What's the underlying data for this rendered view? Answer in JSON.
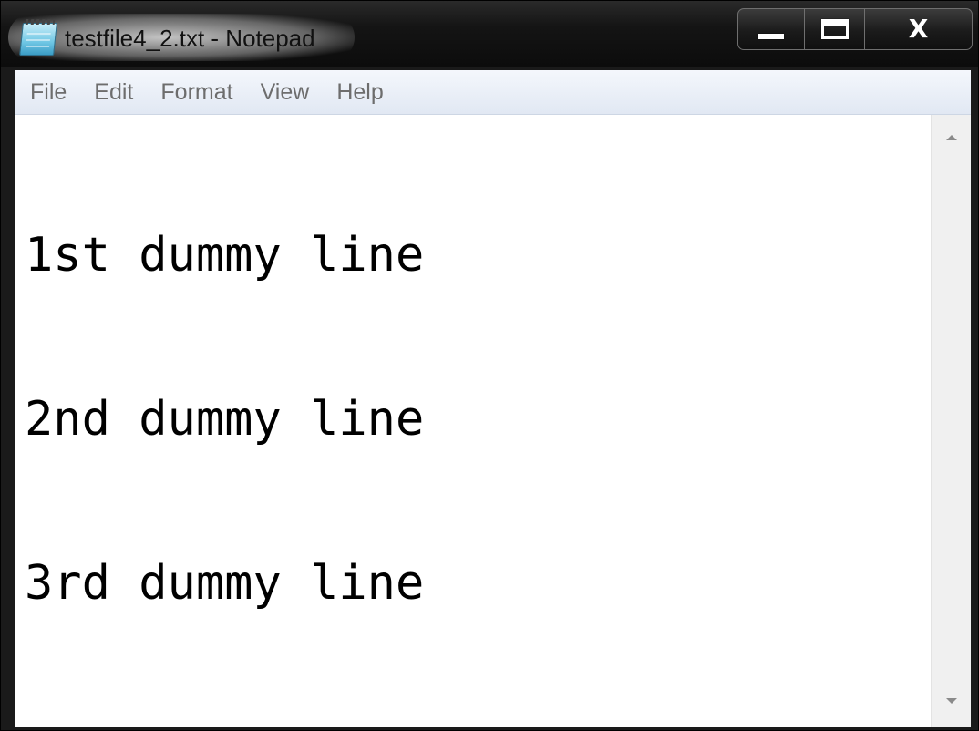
{
  "window": {
    "title": "testfile4_2.txt - Notepad",
    "app_icon": "notepad-icon",
    "controls": {
      "minimize_icon": "minimize-icon",
      "maximize_icon": "maximize-icon",
      "close_icon": "close-icon",
      "close_glyph": "X"
    }
  },
  "menu": {
    "items": [
      {
        "label": "File"
      },
      {
        "label": "Edit"
      },
      {
        "label": "Format"
      },
      {
        "label": "View"
      },
      {
        "label": "Help"
      }
    ]
  },
  "document": {
    "lines": [
      "1st dummy line",
      "2nd dummy line",
      "3rd dummy line"
    ]
  },
  "colors": {
    "title_bar": "#141414",
    "menu_bar": "#e8eef7",
    "menu_text": "#6d6d6d",
    "editor_bg": "#ffffff",
    "text": "#000000"
  }
}
